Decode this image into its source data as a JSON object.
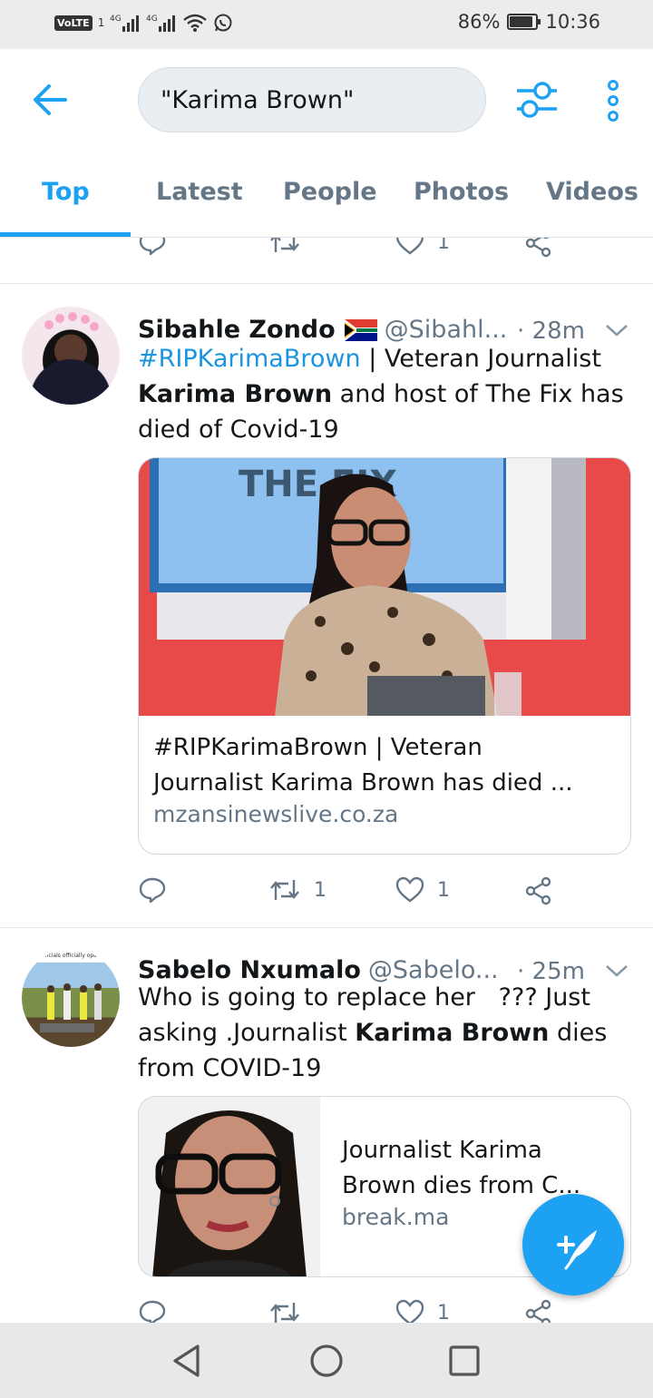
{
  "status_bar": {
    "volte": "VoLTE",
    "sim": "1",
    "net1": "4G",
    "net2": "4G",
    "battery_percent": "86%",
    "battery_level": 0.86,
    "time": "10:36"
  },
  "search": {
    "query": "\"Karima Brown\""
  },
  "tabs": [
    {
      "label": "Top",
      "active": true
    },
    {
      "label": "Latest",
      "active": false
    },
    {
      "label": "People",
      "active": false
    },
    {
      "label": "Photos",
      "active": false
    },
    {
      "label": "Videos",
      "active": false
    }
  ],
  "prev_tweet_actions": {
    "like_count": "1"
  },
  "tweets": [
    {
      "display_name": "Sibahle Zondo",
      "flag_icon": "south-africa-flag-icon",
      "handle": "@Sibahl...",
      "time": "· 28m",
      "hashtag": "#RIPKarimaBrown",
      "text_after_hashtag": " | Veteran Journalist ",
      "bold": "Karima Brown",
      "text_end": " and host of The Fix has died of Covid-19",
      "card": {
        "image_label": "THE FIX",
        "title_line1": "#RIPKarimaBrown | Veteran",
        "title_line2": "Journalist Karima Brown has died ...",
        "domain": "mzansinewslive.co.za"
      },
      "retweet_count": "1",
      "like_count": "1"
    },
    {
      "display_name": "Sabelo Nxumalo",
      "handle": "@Sabelo...",
      "time": "· 25m",
      "avatar_caption": "officials officially ope...",
      "text_start": "Who is going to replace her   ??? Just asking .Journalist ",
      "bold": "Karima Brown",
      "text_end": " dies from COVID-19",
      "card": {
        "title_line1": "Journalist Karima",
        "title_line2": "Brown dies from C...",
        "domain": "break.ma"
      },
      "like_count": "1"
    }
  ],
  "colors": {
    "accent": "#1da1f2",
    "secondary_text": "#657786",
    "hashtag": "#1b95e0"
  }
}
